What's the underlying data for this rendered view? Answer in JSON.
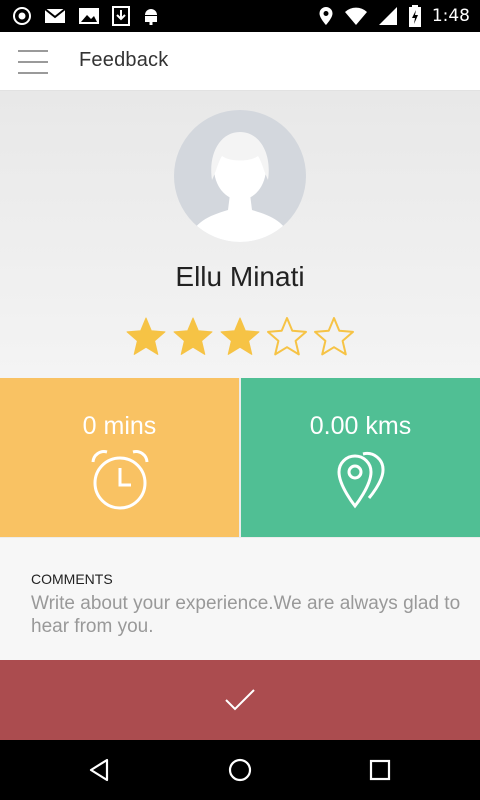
{
  "status_bar": {
    "time": "1:48",
    "icons": [
      "record-icon",
      "gmail-icon",
      "photo-icon",
      "download-icon",
      "android-icon",
      "location-icon",
      "wifi-icon",
      "signal-icon",
      "battery-charging-icon"
    ]
  },
  "app_bar": {
    "title": "Feedback",
    "menu_icon": "hamburger-menu-icon"
  },
  "profile": {
    "name": "Ellu Minati",
    "rating": 3,
    "rating_max": 5,
    "star_color": "#f6c345"
  },
  "stats": {
    "time": {
      "value": "0 mins",
      "icon": "alarm-clock-icon",
      "color": "#f9c263"
    },
    "distance": {
      "value": "0.00 kms",
      "icon": "map-pins-icon",
      "color": "#50bf94"
    }
  },
  "comments": {
    "label": "COMMENTS",
    "placeholder": "Write about your experience.We are always glad to hear from you.",
    "value": ""
  },
  "submit": {
    "icon": "check-icon",
    "color": "#ab4c4f"
  },
  "nav_bar": {
    "icons": [
      "back-icon",
      "home-icon",
      "recents-icon"
    ]
  }
}
